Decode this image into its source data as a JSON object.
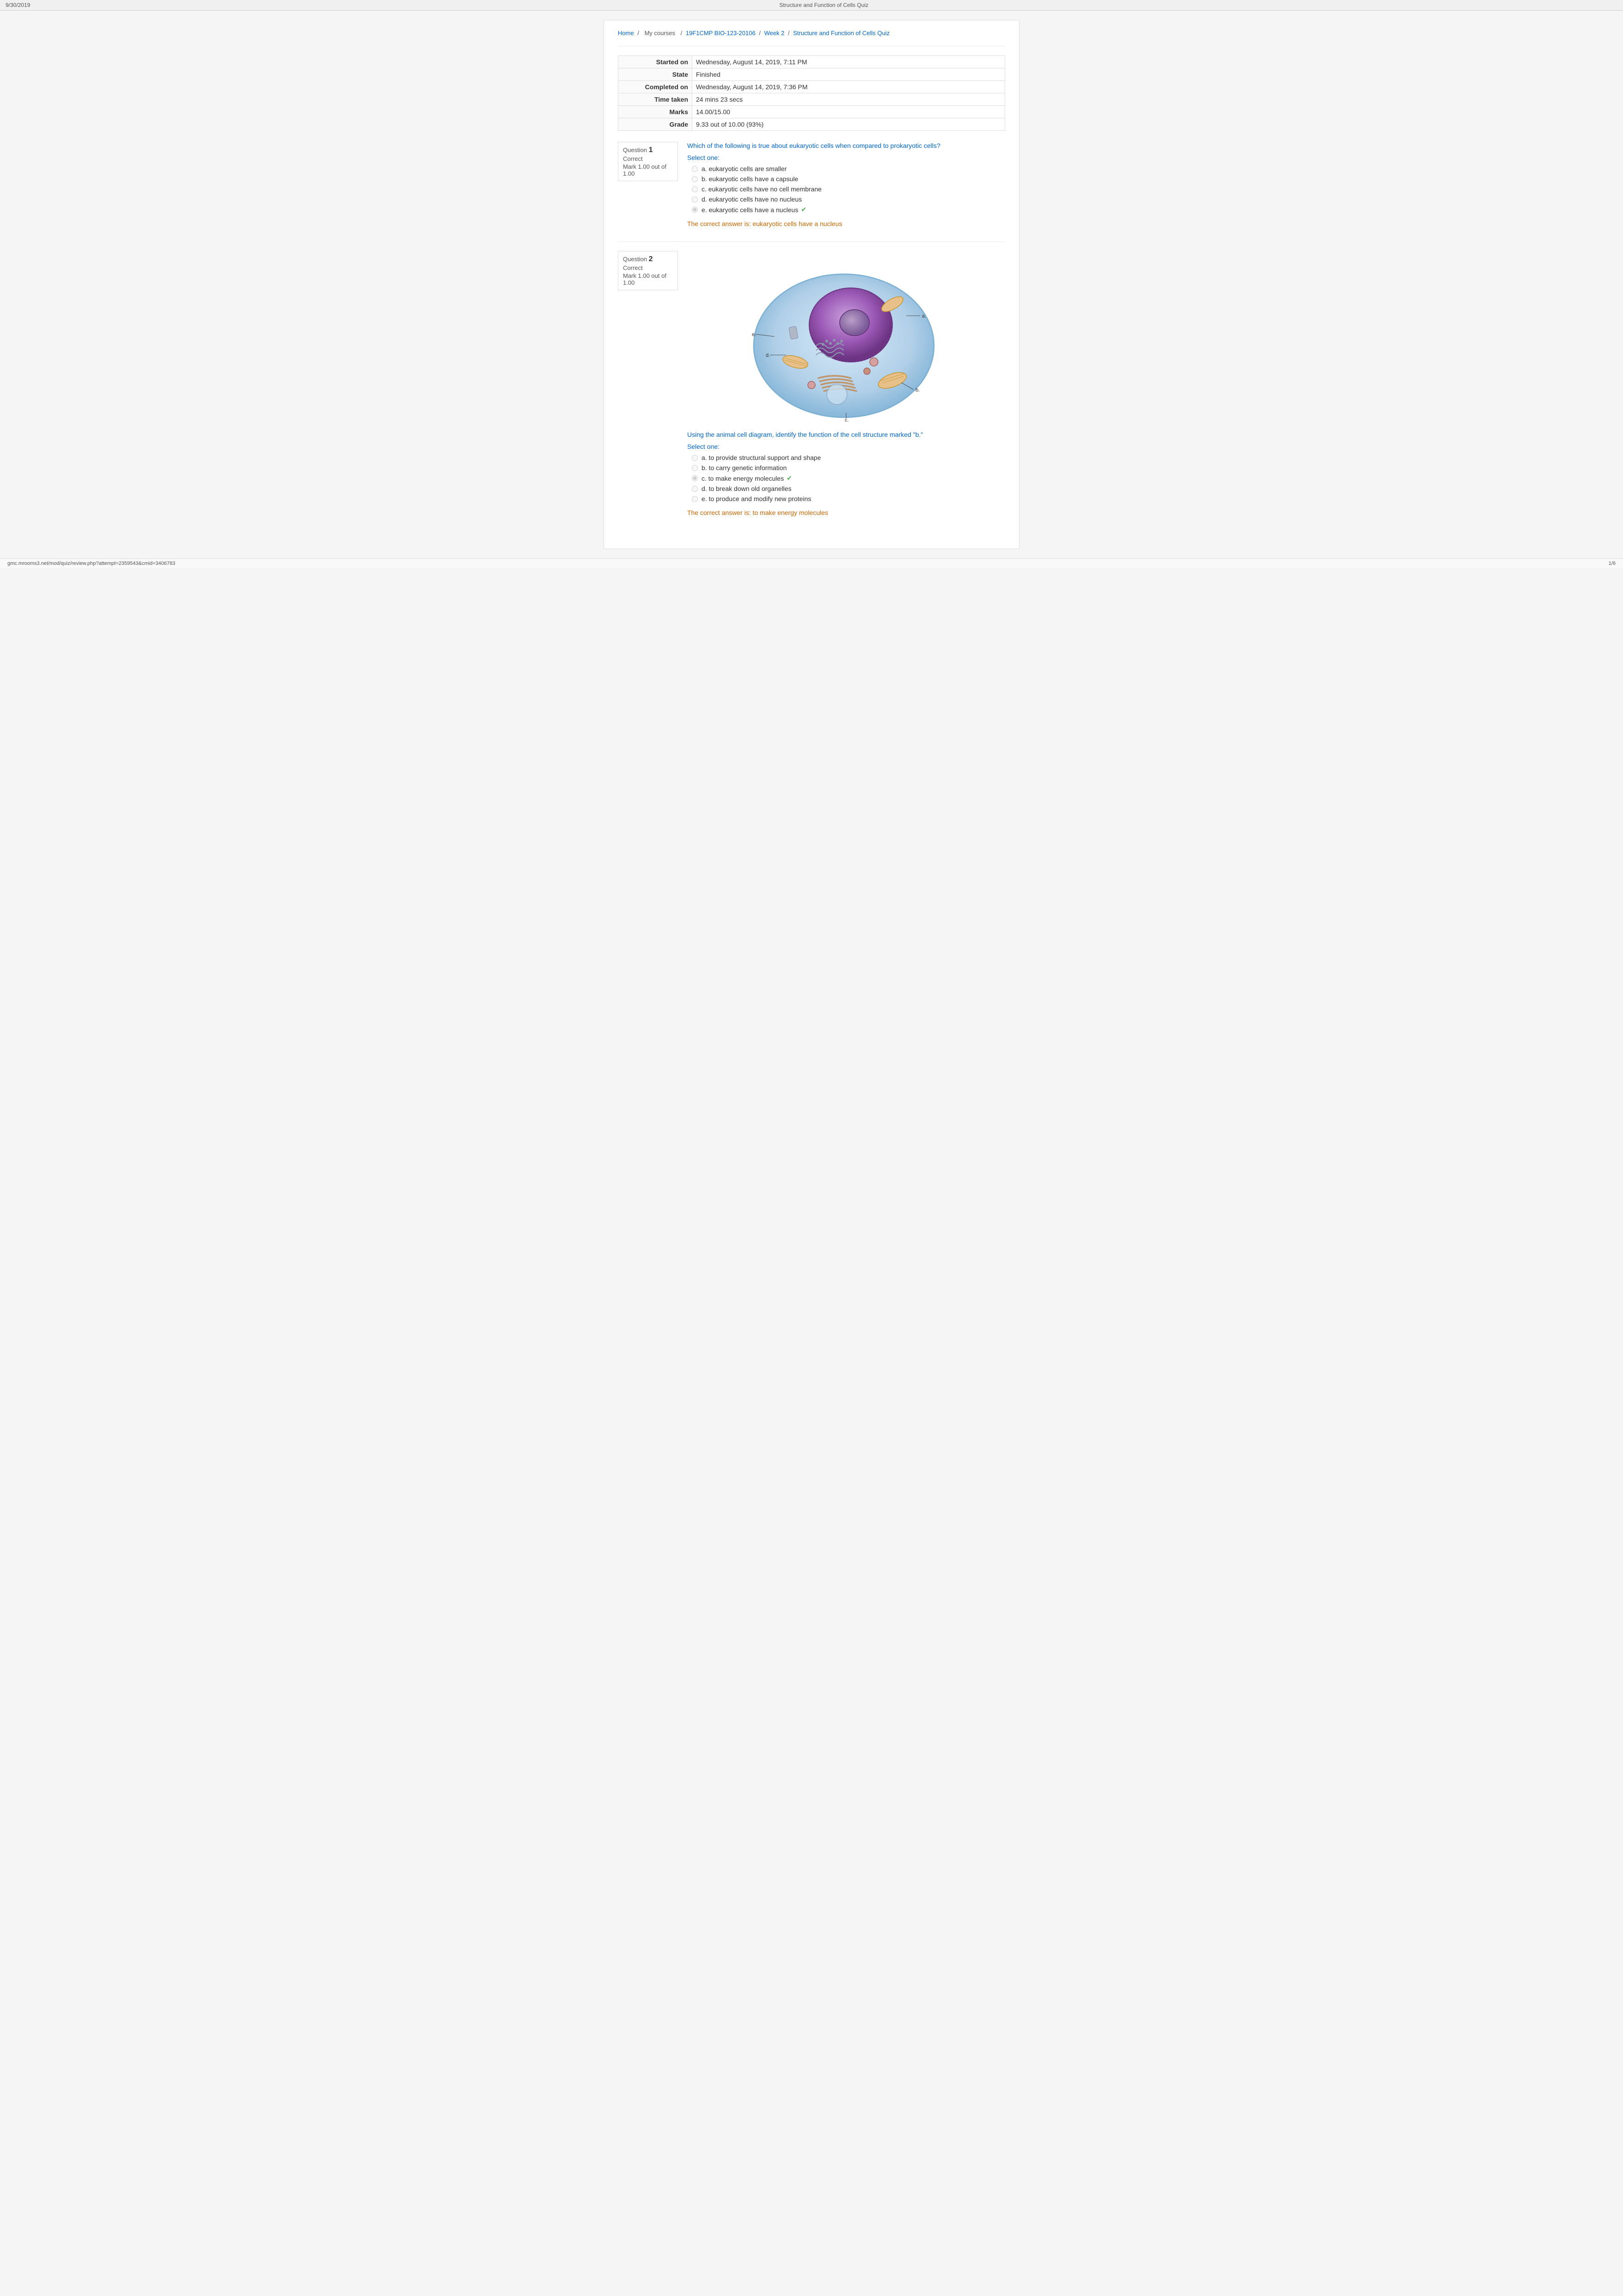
{
  "browser": {
    "date": "9/30/2019",
    "page_title": "Structure and Function of Cells Quiz",
    "url": "gmc.mrooms3.net/mod/quiz/review.php?attempt=2359543&cmid=3406783",
    "page_num": "1/6"
  },
  "breadcrumb": {
    "home": "Home",
    "separator1": "/",
    "my_courses": "My courses",
    "separator2": "/",
    "course": "19F1CMP BIO-123-20106",
    "separator3": "/",
    "week": "Week 2",
    "separator4": "/",
    "quiz": "Structure and Function of Cells Quiz"
  },
  "quiz_info": {
    "started_on_label": "Started on",
    "started_on_value": "Wednesday, August 14, 2019, 7:11 PM",
    "state_label": "State",
    "state_value": "Finished",
    "completed_on_label": "Completed on",
    "completed_on_value": "Wednesday, August 14, 2019, 7:36 PM",
    "time_taken_label": "Time taken",
    "time_taken_value": "24 mins 23 secs",
    "marks_label": "Marks",
    "marks_value": "14.00/15.00",
    "grade_label": "Grade",
    "grade_value": "9.33 out of 10.00 (93%)"
  },
  "question1": {
    "number": "1",
    "status": "Correct",
    "mark": "Mark 1.00 out of 1.00",
    "question_text": "Which of the following is true about eukaryotic cells when compared to prokaryotic cells?",
    "select_label": "Select one:",
    "options": [
      {
        "label": "a. eukaryotic cells are smaller",
        "selected": false,
        "correct": false
      },
      {
        "label": "b. eukaryotic cells have a capsule",
        "selected": false,
        "correct": false
      },
      {
        "label": "c. eukaryotic cells have no cell membrane",
        "selected": false,
        "correct": false
      },
      {
        "label": "d. eukaryotic cells have no nucleus",
        "selected": false,
        "correct": false
      },
      {
        "label": "e. eukaryotic cells have a nucleus",
        "selected": true,
        "correct": true
      }
    ],
    "correct_answer": "The correct answer is: eukaryotic cells have a nucleus"
  },
  "question2": {
    "number": "2",
    "status": "Correct",
    "mark": "Mark 1.00 out of 1.00",
    "question_text": "Using the animal cell diagram, identify the function of the cell structure marked \"b.\"",
    "select_label": "Select one:",
    "options": [
      {
        "label": "a. to provide structural support and shape",
        "selected": false,
        "correct": false
      },
      {
        "label": "b. to carry genetic information",
        "selected": false,
        "correct": false
      },
      {
        "label": "c. to make energy molecules",
        "selected": true,
        "correct": true
      },
      {
        "label": "d. to break down old organelles",
        "selected": false,
        "correct": false
      },
      {
        "label": "e. to produce and modify new proteins",
        "selected": false,
        "correct": false
      }
    ],
    "correct_answer": "The correct answer is: to make energy molecules"
  }
}
